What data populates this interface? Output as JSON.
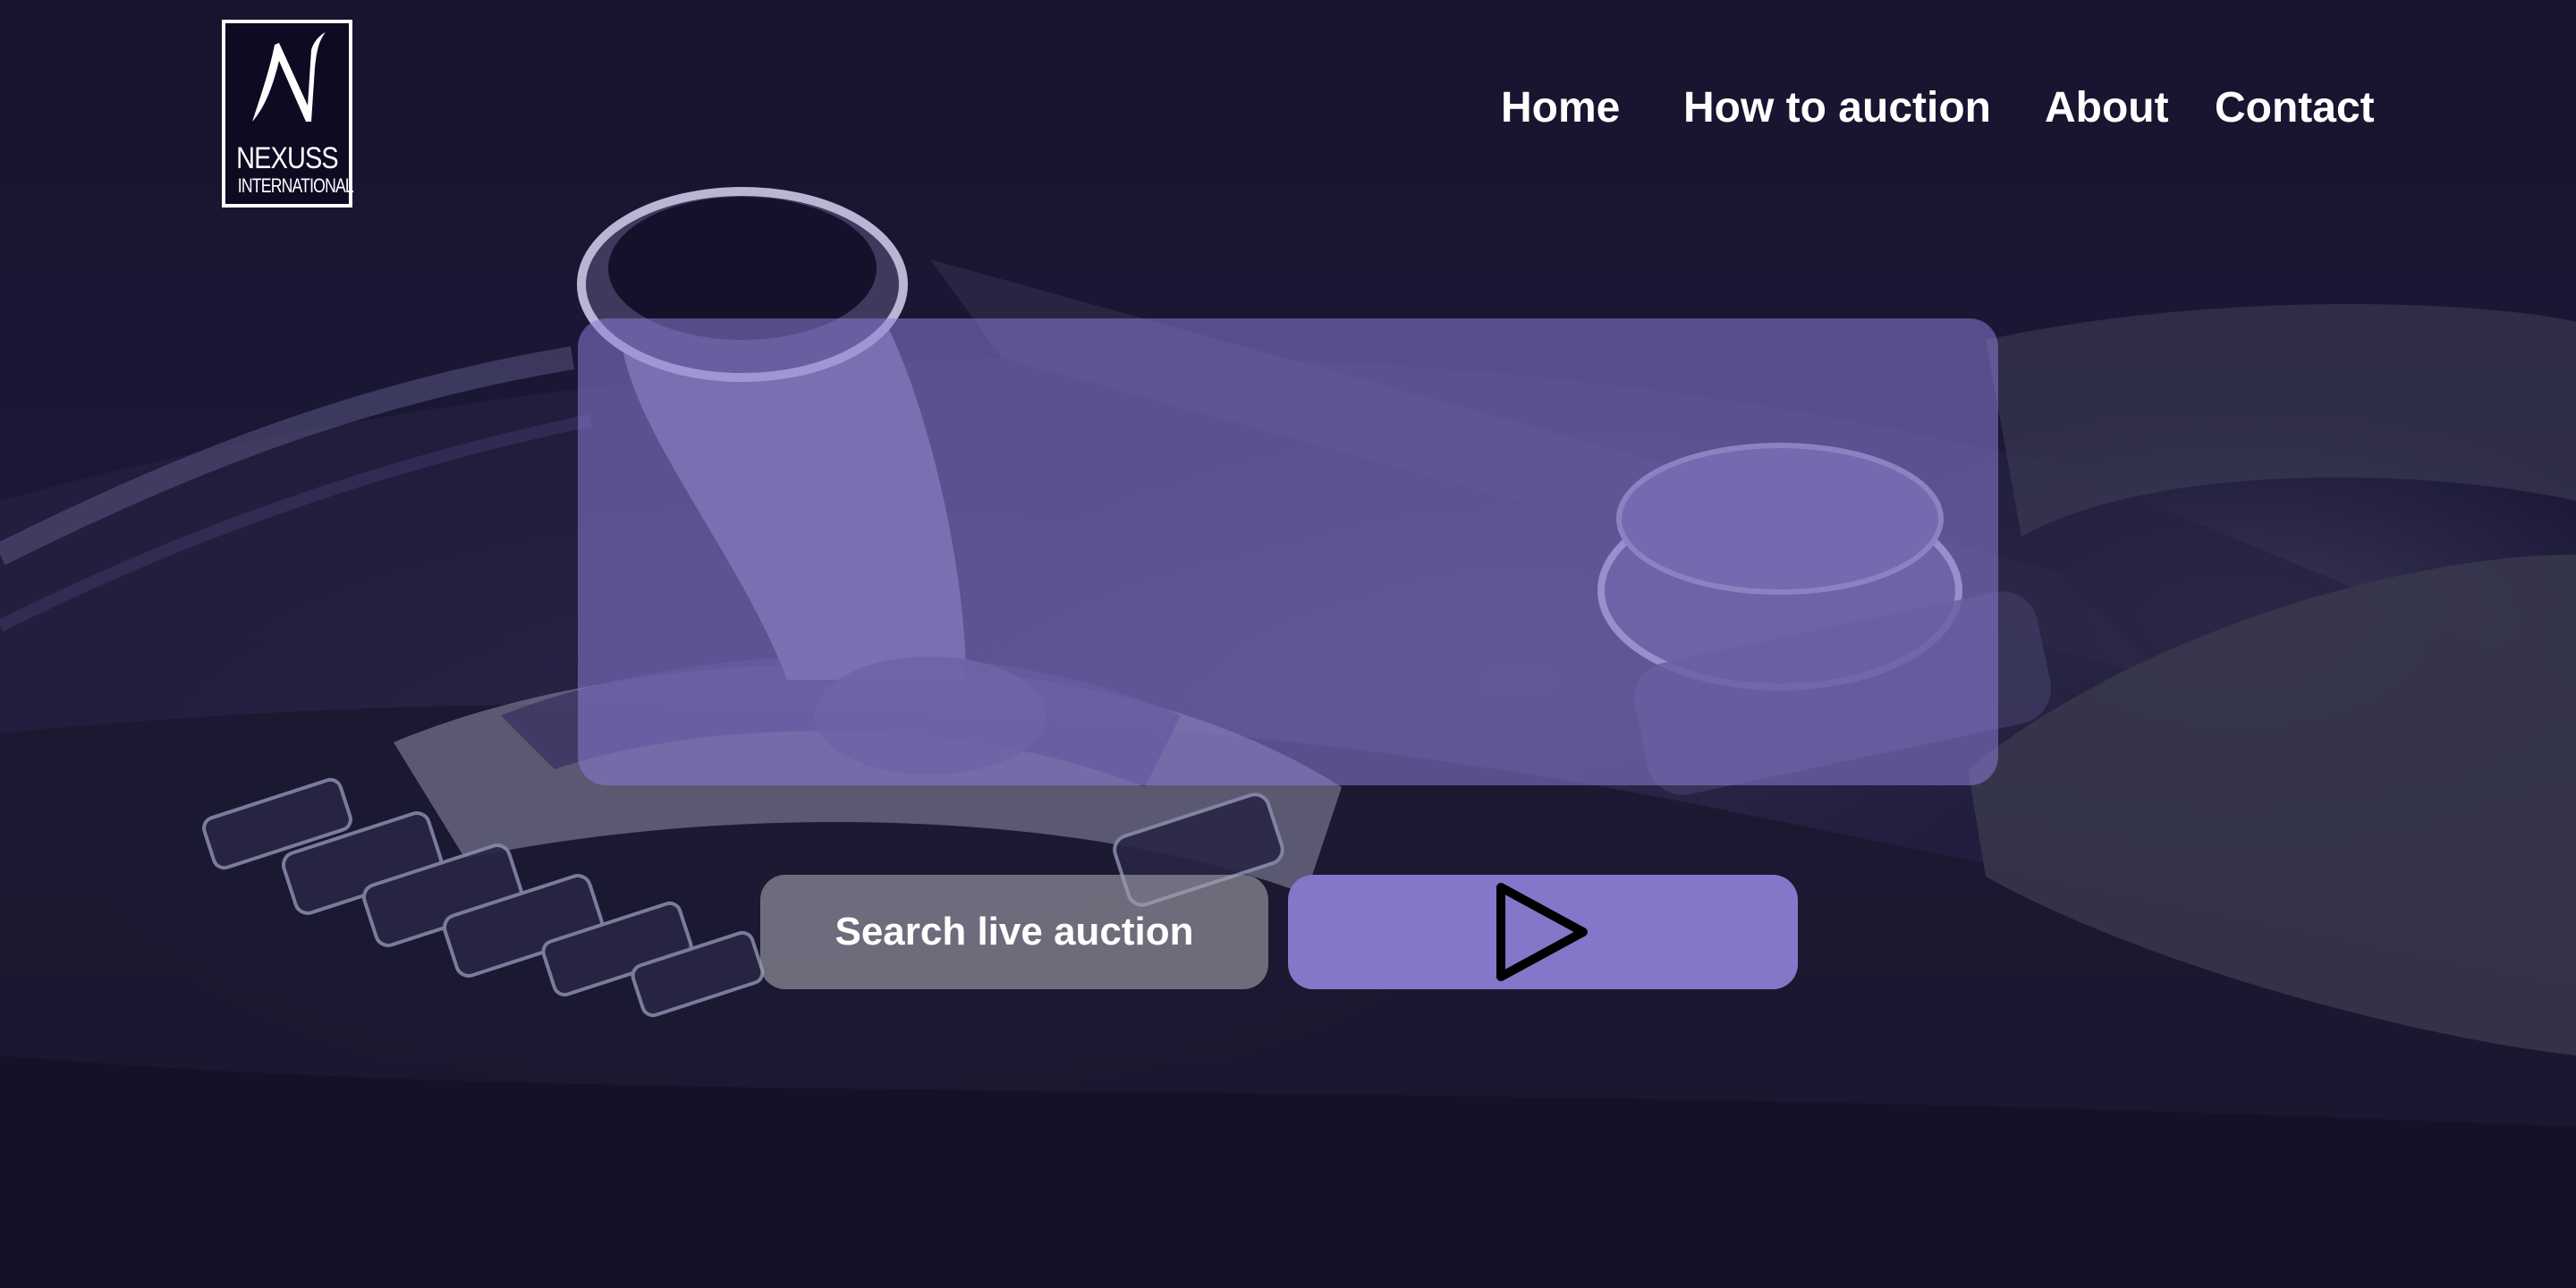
{
  "logo": {
    "letter": "N",
    "line1": "NEXUSS",
    "line2": "INTERNATIONAL"
  },
  "nav": {
    "items": [
      {
        "label": "Home"
      },
      {
        "label": "How to auction"
      },
      {
        "label": "About"
      },
      {
        "label": "Contact"
      }
    ]
  },
  "search": {
    "label": "Search live auction"
  },
  "play_button": {
    "icon": "play-icon"
  },
  "colors": {
    "background": "#15132b",
    "panel": "#8c7cd6",
    "accent": "#8676c9",
    "text": "#ffffff"
  }
}
